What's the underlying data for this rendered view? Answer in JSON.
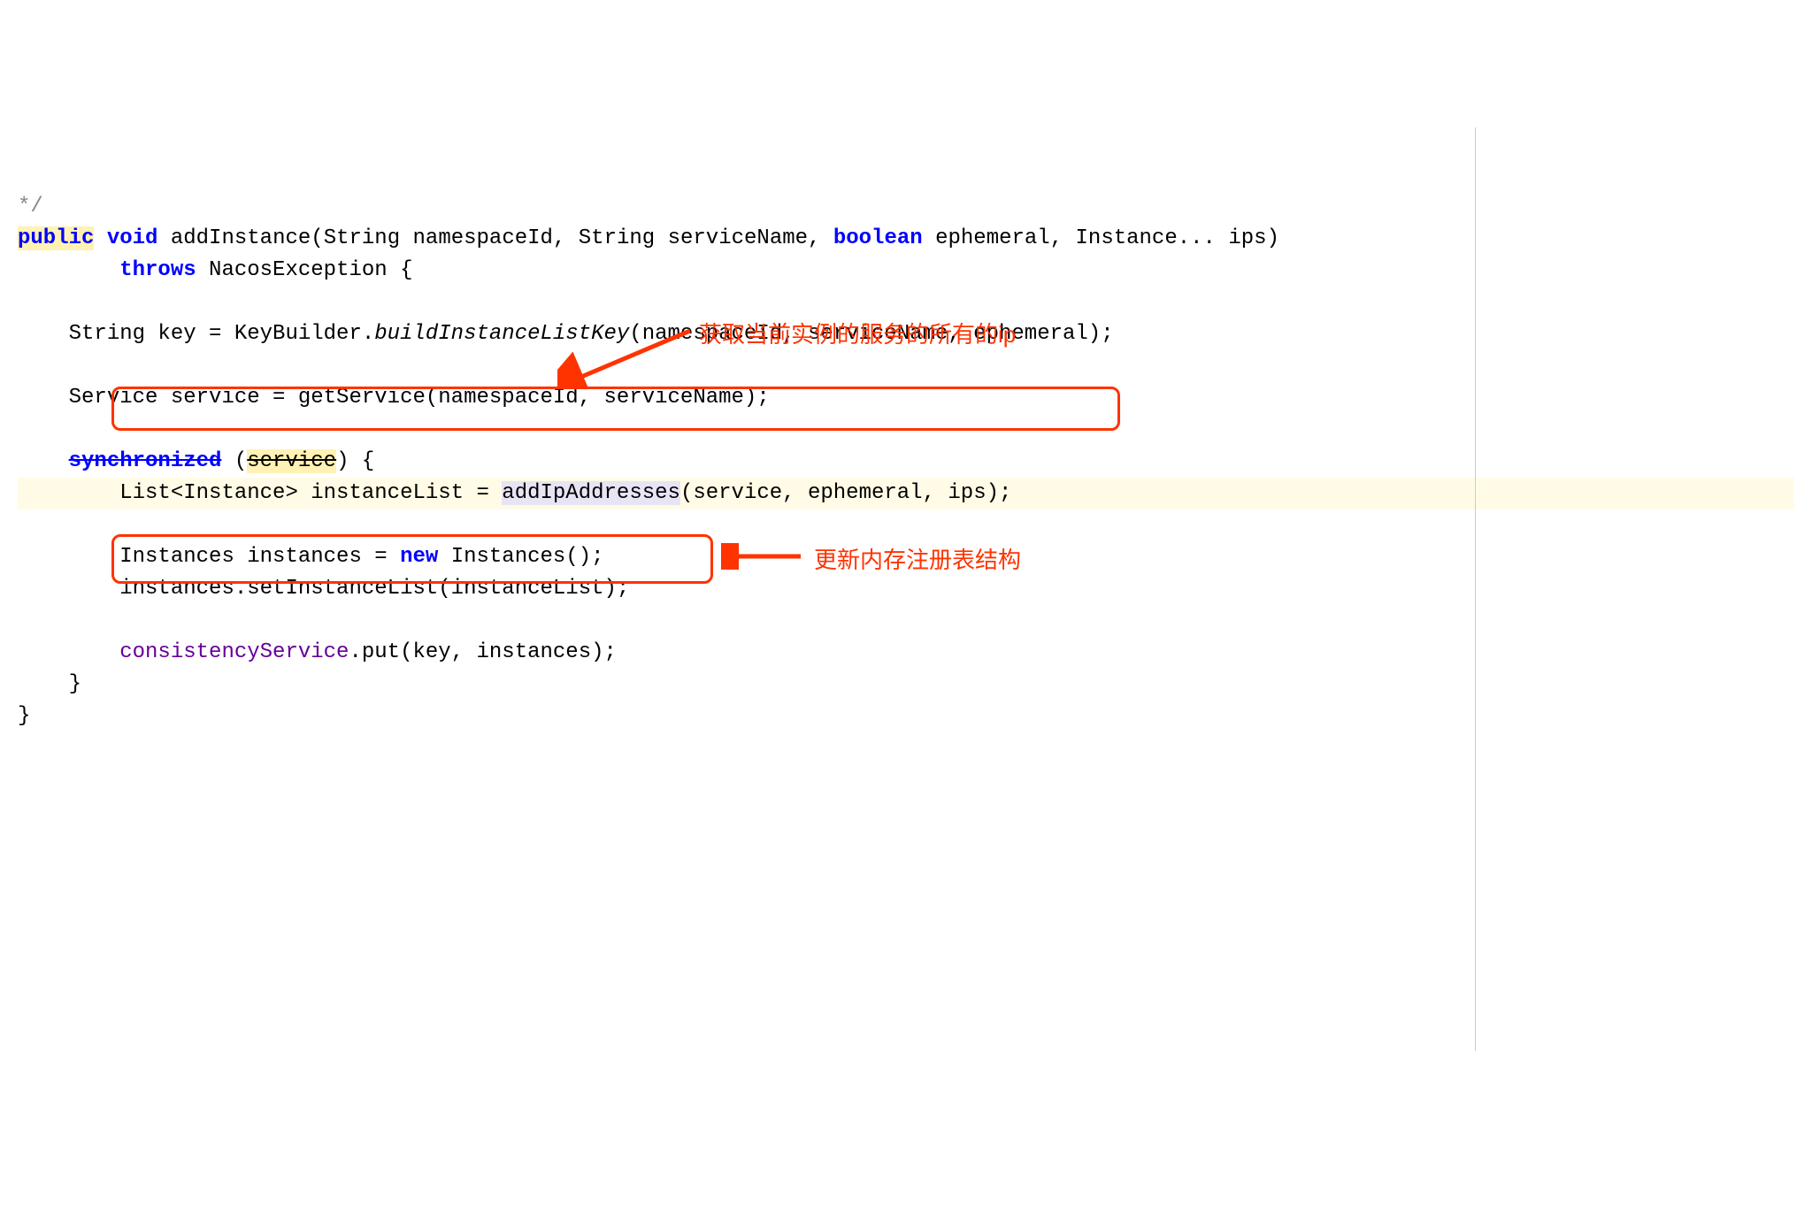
{
  "code": {
    "comment_tail": "*/",
    "kw_public": "public",
    "kw_void": "void",
    "method_name": "addInstance",
    "param_type1": "String",
    "param_name1": "namespaceId",
    "param_type2": "String",
    "param_name2": "serviceName",
    "kw_boolean": "boolean",
    "param_name3": "ephemeral",
    "param_type4": "Instance...",
    "param_name4": "ips",
    "kw_throws": "throws",
    "exception_type": "NacosException",
    "line_key_decl": "String key = KeyBuilder.",
    "build_method": "buildInstanceListKey",
    "build_args": "(namespaceId, serviceName, ephemeral);",
    "line_service_decl": "Service service = getService(namespaceId, serviceName);",
    "kw_synchronized": "synchronized",
    "sync_arg_open": " (",
    "sync_arg": "service",
    "sync_arg_close": ") {",
    "list_decl": "List<Instance> instanceList = ",
    "addip_method": "addIpAddresses",
    "addip_args": "(service, ephemeral, ips);",
    "instances_decl1": "Instances instances = ",
    "kw_new": "new",
    "instances_decl2": " Instances();",
    "set_instance_list": "instances.setInstanceList(instanceList);",
    "consistency_field": "consistencyService",
    "put_call": ".put(key, instances);",
    "brace_close1": "}",
    "brace_close2": "}"
  },
  "annotations": {
    "top": "获取当前实例的服务的所有的ip",
    "bottom": "更新内存注册表结构"
  }
}
